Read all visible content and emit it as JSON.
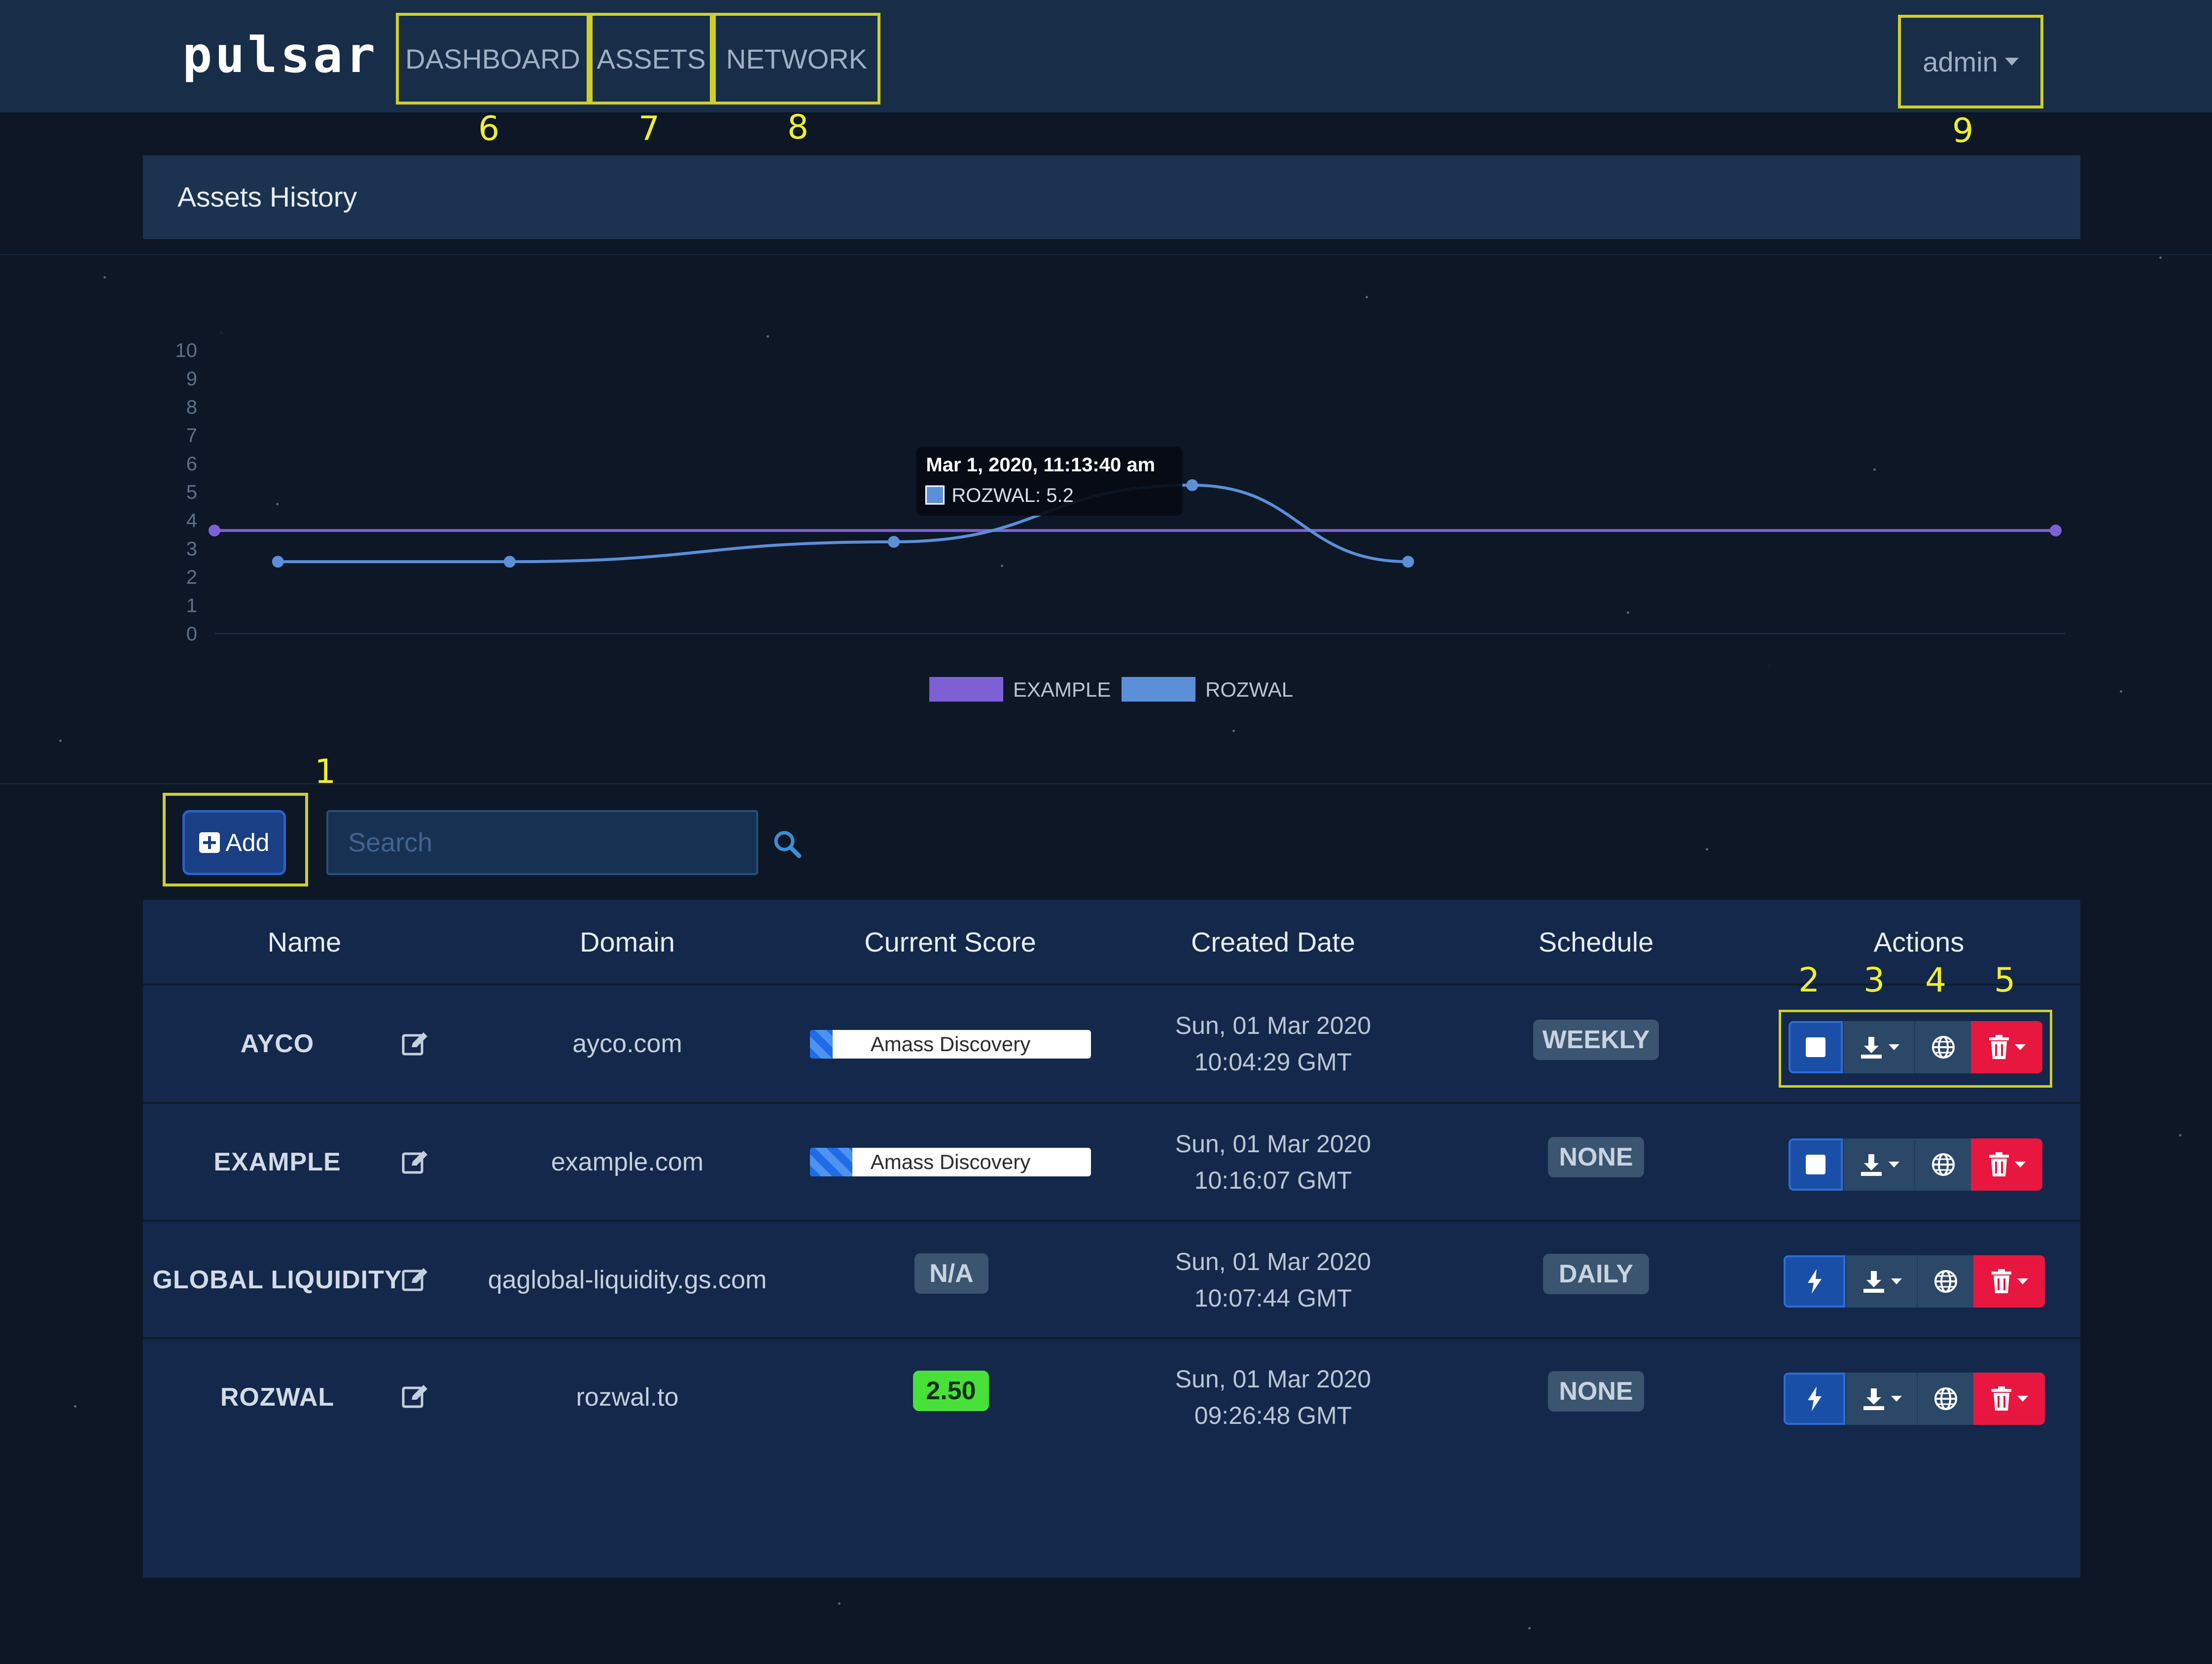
{
  "app": {
    "logo": "pulsar"
  },
  "nav": {
    "items": [
      {
        "label": "DASHBOARD",
        "callout": "6"
      },
      {
        "label": "ASSETS",
        "callout": "7"
      },
      {
        "label": "NETWORK",
        "callout": "8"
      }
    ],
    "user": {
      "label": "admin",
      "callout": "9"
    }
  },
  "panel": {
    "title": "Assets History"
  },
  "chart_data": {
    "type": "line",
    "y_ticks": [
      "0",
      "1",
      "2",
      "3",
      "4",
      "5",
      "6",
      "7",
      "8",
      "9",
      "10"
    ],
    "ylim": [
      0,
      10
    ],
    "xlim": [
      0,
      29
    ],
    "grid": false,
    "legend_position": "bottom-center",
    "series": [
      {
        "name": "EXAMPLE",
        "color": "#7d5fd6",
        "points": [
          [
            0,
            3.6
          ],
          [
            29,
            3.6
          ]
        ]
      },
      {
        "name": "ROZWAL",
        "color": "#5b8fd8",
        "points": [
          [
            1,
            2.5
          ],
          [
            4.65,
            2.5
          ],
          [
            10.7,
            3.2
          ],
          [
            15.4,
            5.2
          ],
          [
            18.8,
            2.5
          ]
        ]
      }
    ],
    "tooltip": {
      "title": "Mar 1, 2020, 11:13:40 am",
      "label": "ROZWAL: 5.2"
    }
  },
  "toolbar": {
    "add_label": "Add",
    "add_callout": "1",
    "search_placeholder": "Search"
  },
  "table": {
    "headers": [
      "Name",
      "Domain",
      "Current Score",
      "Created Date",
      "Schedule",
      "Actions"
    ],
    "action_callouts": [
      "2",
      "3",
      "4",
      "5"
    ],
    "rows": [
      {
        "name": "AYCO",
        "domain": "ayco.com",
        "score_type": "progress",
        "score": "Amass Discovery",
        "date_line1": "Sun, 01 Mar 2020",
        "date_line2": "10:04:29 GMT",
        "schedule": "WEEKLY",
        "scan_icon": "stop-icon"
      },
      {
        "name": "EXAMPLE",
        "domain": "example.com",
        "score_type": "progress",
        "score": "Amass Discovery",
        "date_line1": "Sun, 01 Mar 2020",
        "date_line2": "10:16:07 GMT",
        "schedule": "NONE",
        "scan_icon": "stop-icon"
      },
      {
        "name": "GLOBAL LIQUIDITY",
        "domain": "qaglobal-liquidity.gs.com",
        "score_type": "badge-gray",
        "score": "N/A",
        "date_line1": "Sun, 01 Mar 2020",
        "date_line2": "10:07:44 GMT",
        "schedule": "DAILY",
        "scan_icon": "bolt-icon"
      },
      {
        "name": "ROZWAL",
        "domain": "rozwal.to",
        "score_type": "badge-green",
        "score": "2.50",
        "date_line1": "Sun, 01 Mar 2020",
        "date_line2": "09:26:48 GMT",
        "schedule": "NONE",
        "scan_icon": "bolt-icon"
      }
    ]
  },
  "colors": {
    "navbar": "#182d47",
    "panel": "#1b3250",
    "table": "#13284a",
    "primary": "#1a4fa8",
    "danger": "#e8173f",
    "callout": "#f0ee2a",
    "success": "#47e13a"
  }
}
